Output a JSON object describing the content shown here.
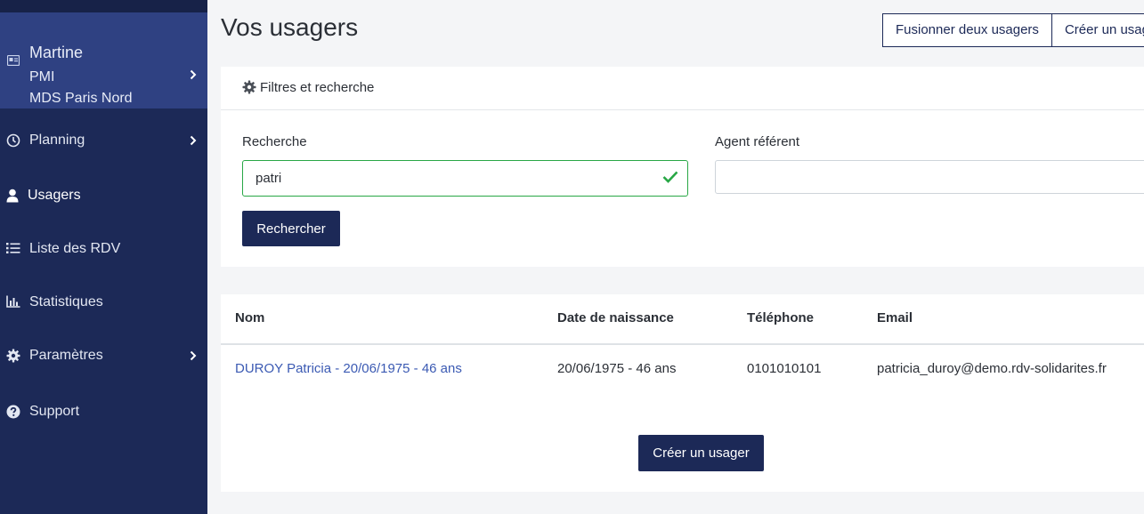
{
  "sidebar": {
    "profile": {
      "name": "Martine",
      "organisation": "PMI",
      "lieu": "MDS Paris Nord"
    },
    "items": [
      {
        "label": "Planning",
        "icon": "clock-icon",
        "has_submenu": true
      },
      {
        "label": "Usagers",
        "icon": "user-icon",
        "active": true
      },
      {
        "label": "Liste des RDV",
        "icon": "list-icon"
      },
      {
        "label": "Statistiques",
        "icon": "bar-chart-icon"
      },
      {
        "label": "Paramètres",
        "icon": "gear-icon",
        "has_submenu": true
      },
      {
        "label": "Support",
        "icon": "question-circle-icon"
      }
    ]
  },
  "header": {
    "title": "Vos usagers",
    "merge_button": "Fusionner deux usagers",
    "create_button": "Créer un usager"
  },
  "filters": {
    "title": "Filtres et recherche",
    "search_label": "Recherche",
    "search_value": "patri",
    "agent_label": "Agent référent",
    "agent_value": "",
    "submit_label": "Rechercher"
  },
  "results": {
    "columns": [
      "Nom",
      "Date de naissance",
      "Téléphone",
      "Email"
    ],
    "rows": [
      {
        "nom": "DUROY Patricia - 20/06/1975 - 46 ans",
        "naissance": "20/06/1975 - 46 ans",
        "telephone": "0101010101",
        "email": "patricia_duroy@demo.rdv-solidarites.fr"
      }
    ],
    "create_button": "Créer un usager"
  },
  "colors": {
    "sidebar": "#1c2957",
    "profile": "#2f4182",
    "accent": "#1c2957",
    "link": "#3b5ab3",
    "valid": "#28a745"
  }
}
